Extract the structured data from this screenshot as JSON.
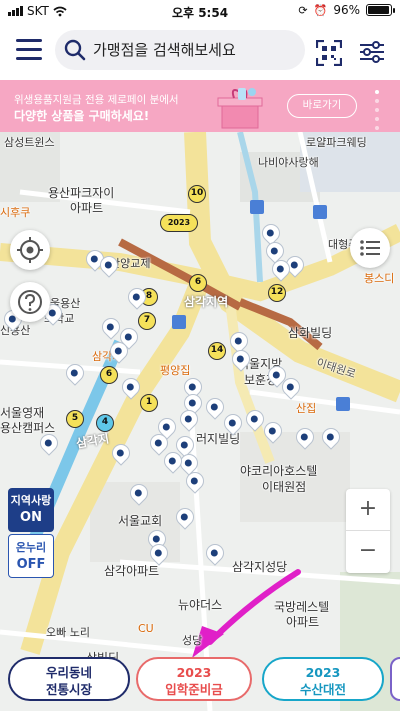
{
  "status_bar": {
    "carrier": "SKT",
    "time": "오후 5:54",
    "battery": "96%"
  },
  "header": {
    "search_placeholder": "가맹점을 검색해보세요"
  },
  "banner": {
    "line1": "위생용품지원금 전용 제로페이 분에서",
    "line2": "다양한 상품을 구매하세요!",
    "button": "바로가기"
  },
  "map": {
    "labels": {
      "samsung": "삼성트윈스",
      "wonhyo": "로얄파크웨딩",
      "nabi": "나비야사랑해",
      "park1": "용산파크자이",
      "park2": "아파트",
      "sisa": "시후쿠",
      "daehyeong": "대형주차장",
      "bongs": "봉스디",
      "yeongcheon": "산양교제",
      "ulsan": "울용산",
      "school": "소학교",
      "sinyongsan": "신용산",
      "station": "삼각지역",
      "station2": "삼각지역",
      "samhwa": "삼화빌딩",
      "pyeongyang": "평양집",
      "office": "서울지방",
      "office2": "보훈청",
      "itaewonro": "이태원로",
      "sam": "삼각지",
      "sam2": "산집",
      "seoul": "서울영재",
      "seoul2": "용산캠퍼스",
      "samgak": "삼각지",
      "samgak2": "러지빌딩",
      "hotel": "야코리아호스텔",
      "hotel2": "이태원점",
      "church": "서울교회",
      "apt": "삼각아파트",
      "samgakst": "삼각지성당",
      "newties": "뉴야더스",
      "kukbang": "국방레스텔",
      "kukbang2": "아파트",
      "cu": "CU",
      "sambil": "삼빌딩",
      "ohbeu": "오빠 노리",
      "sung": "성당"
    },
    "clusters": [
      "10",
      "2023",
      "6",
      "8",
      "7",
      "12",
      "14",
      "6",
      "5",
      "1",
      "4"
    ],
    "toggles": [
      {
        "title": "지역사랑",
        "value": "ON"
      },
      {
        "title": "온누리",
        "value": "OFF"
      }
    ],
    "zoom_in": "+",
    "zoom_out": "−"
  },
  "chips": [
    {
      "line1": "우리동네",
      "line2": "전통시장"
    },
    {
      "line1": "2023",
      "line2": "입학준비금"
    },
    {
      "line1": "2023",
      "line2": "수산대전"
    }
  ],
  "colors": {
    "navy": "#1f2b6a",
    "banner": "#f6a7c3",
    "arrow": "#e020c8"
  }
}
